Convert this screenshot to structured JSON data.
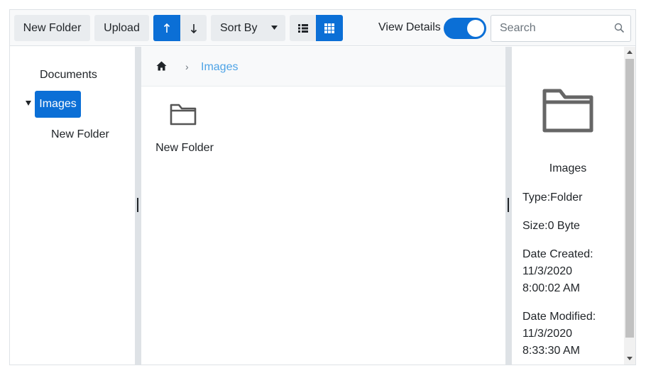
{
  "toolbar": {
    "new_folder_label": "New Folder",
    "upload_label": "Upload",
    "sort_by_label": "Sort By",
    "view_details_label": "View Details",
    "view_details_on": true
  },
  "search": {
    "placeholder": "Search"
  },
  "navigation": {
    "items": [
      {
        "label": "Documents"
      },
      {
        "label": "Images",
        "selected": true,
        "expanded": true
      },
      {
        "label": "New Folder"
      }
    ]
  },
  "breadcrumb": {
    "current": "Images"
  },
  "content": {
    "items": [
      {
        "label": "New Folder",
        "type": "folder"
      }
    ]
  },
  "details": {
    "name": "Images",
    "type": "Type:Folder",
    "size": "Size:0 Byte",
    "created_label": "Date Created:",
    "created_date": "11/3/2020",
    "created_time": "8:00:02 AM",
    "modified_label": "Date Modified:",
    "modified_date": "11/3/2020",
    "modified_time": "8:33:30 AM"
  },
  "colors": {
    "accent": "#0b6fd6",
    "link": "#4da3e6",
    "toolbar_bg": "#e9ecef"
  }
}
